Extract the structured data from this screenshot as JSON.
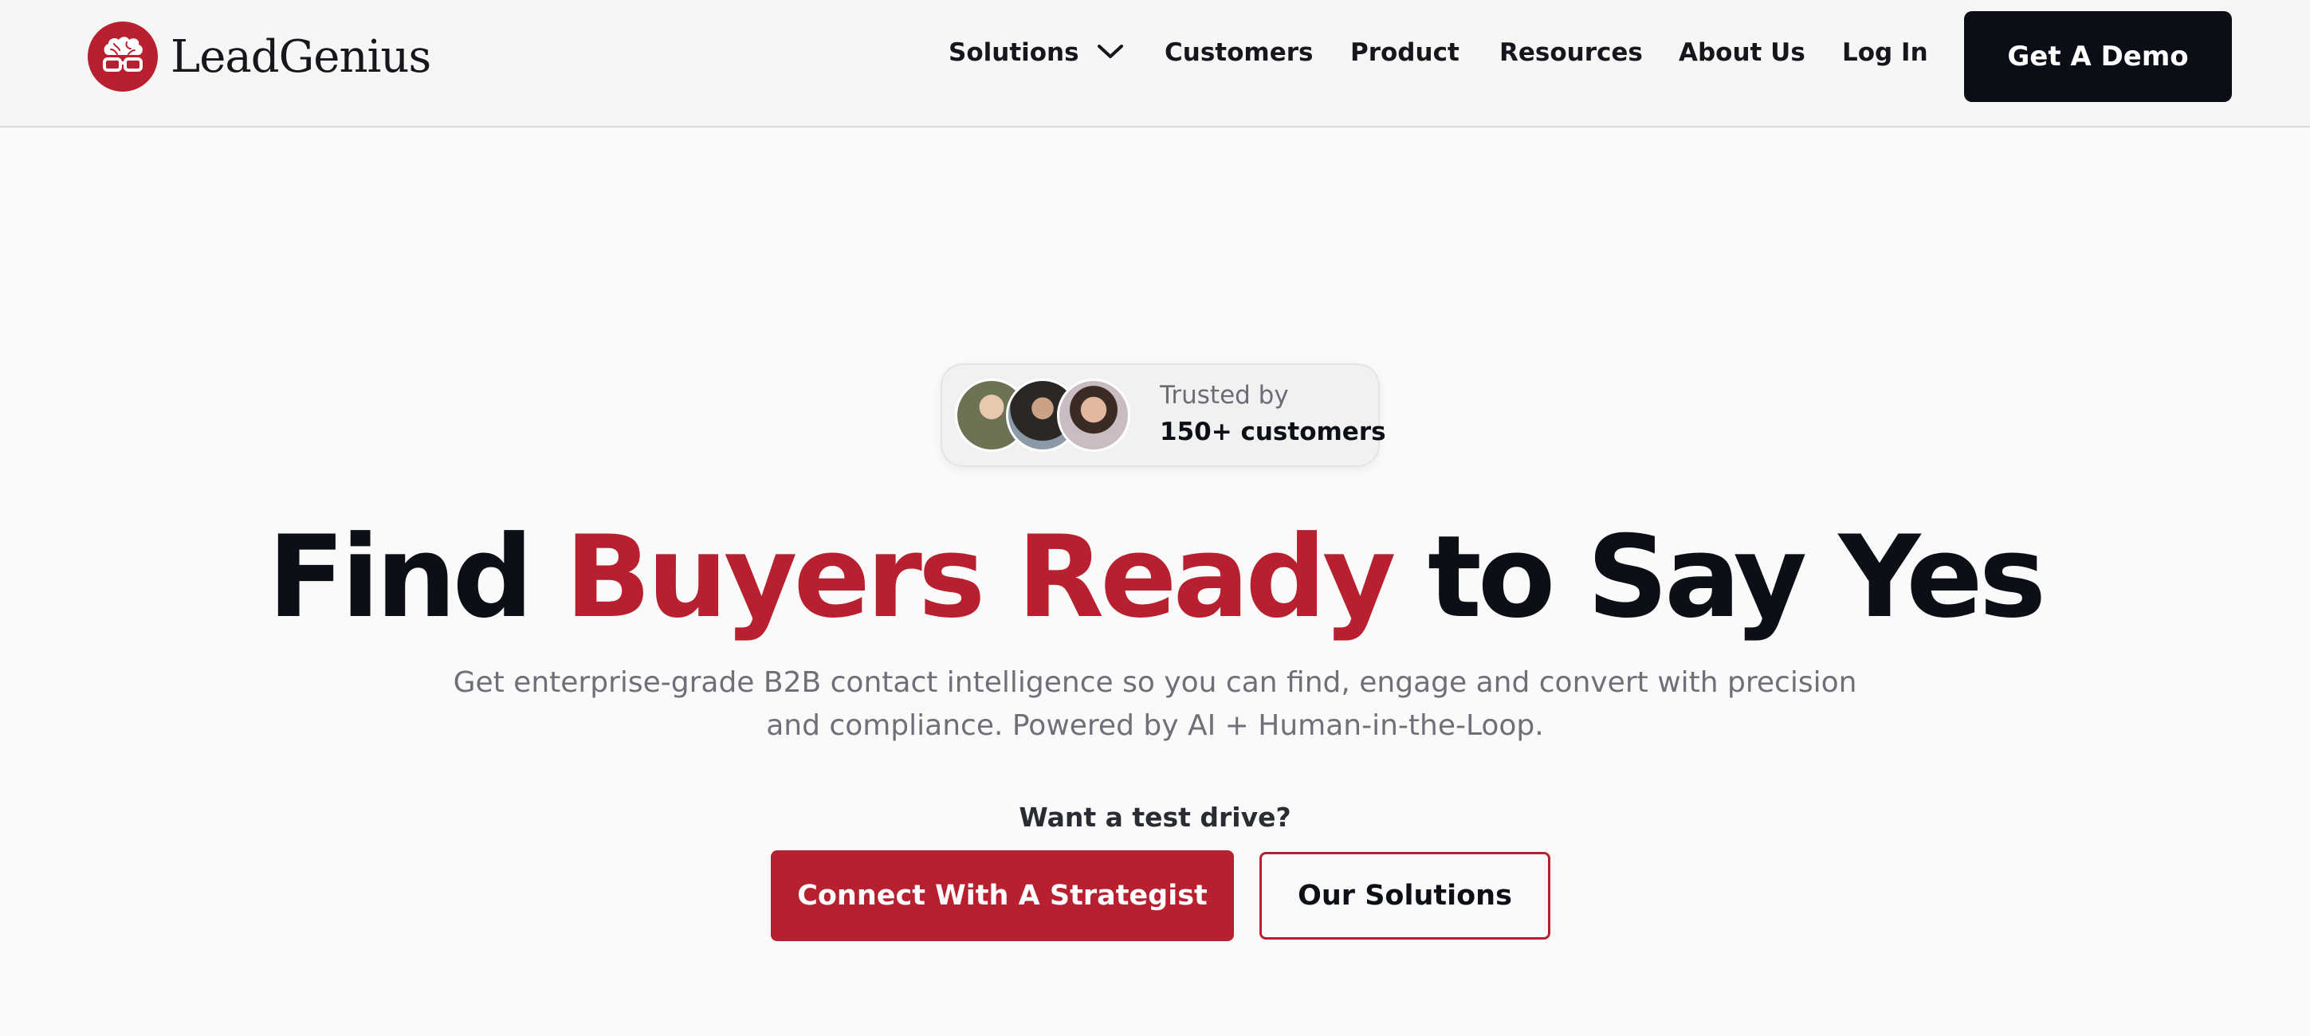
{
  "header": {
    "logo_text": "LeadGenius",
    "logo_icon": "brain-glasses-icon",
    "nav": {
      "solutions": "Solutions",
      "customers": "Customers",
      "product": "Product",
      "resources": "Resources",
      "about": "About Us",
      "login": "Log In"
    },
    "demo_button": "Get A Demo"
  },
  "trust": {
    "line1": "Trusted by",
    "line2": "150+ customers"
  },
  "hero": {
    "headline_part1": "Find ",
    "headline_accent": "Buyers Ready",
    "headline_part2": " to Say Yes",
    "subtext": "Get enterprise-grade B2B contact intelligence so you can find, engage and convert with precision and compliance. Powered by AI + Human-in-the-Loop.",
    "test_drive": "Want a test drive?",
    "primary_cta": "Connect With A Strategist",
    "secondary_cta": "Our Solutions"
  },
  "colors": {
    "brand_red": "#b8202f",
    "dark": "#0b0d17",
    "background": "#fafafa"
  }
}
